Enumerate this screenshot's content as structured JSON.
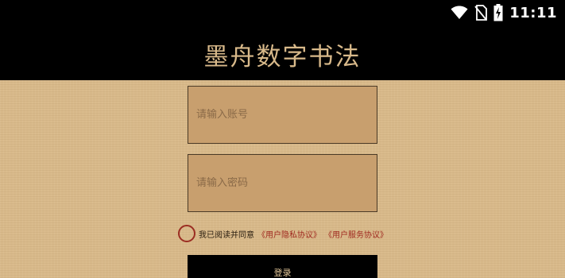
{
  "status_bar": {
    "time": "11:11",
    "icons": [
      "wifi-icon",
      "no-sim-icon",
      "battery-charging-icon"
    ]
  },
  "header": {
    "title": "墨舟数字书法"
  },
  "form": {
    "account_placeholder": "请输入账号",
    "password_placeholder": "请输入密码",
    "agreement_prefix": "我已阅读并同意",
    "privacy_link": "《用户隐私协议》",
    "service_link": "《用户服务协议》",
    "login_label": "登录"
  },
  "colors": {
    "header_bg": "#000000",
    "title_color": "#d8b98a",
    "paper_bg": "#d8b98a",
    "field_bg": "#c89f6e",
    "link_color": "#a02a20",
    "checkbox_border": "#9b2d22"
  }
}
